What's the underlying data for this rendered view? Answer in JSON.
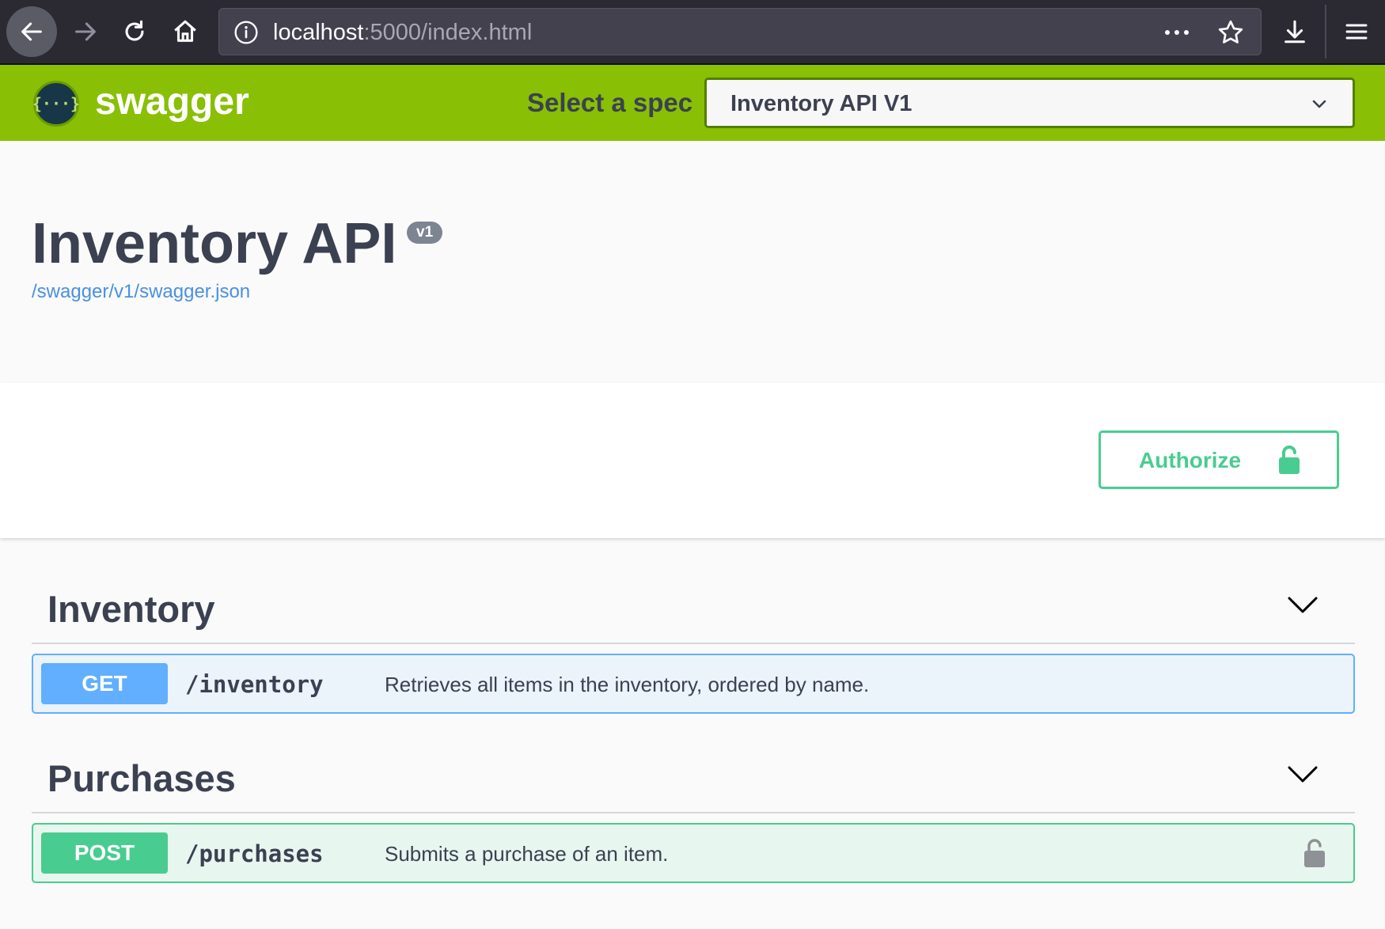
{
  "browser": {
    "url_host": "localhost",
    "url_rest": ":5000/index.html"
  },
  "topbar": {
    "logo_text": "swagger",
    "logo_glyph": "{···}",
    "spec_label": "Select a spec",
    "spec_selected": "Inventory API V1"
  },
  "info": {
    "title": "Inventory API",
    "version": "v1",
    "spec_url": "/swagger/v1/swagger.json"
  },
  "auth": {
    "authorize_label": "Authorize"
  },
  "tags": [
    {
      "name": "Inventory",
      "operations": [
        {
          "method": "GET",
          "path": "/inventory",
          "summary": "Retrieves all items in the inventory, ordered by name.",
          "locked": false
        }
      ]
    },
    {
      "name": "Purchases",
      "operations": [
        {
          "method": "POST",
          "path": "/purchases",
          "summary": "Submits a purchase of an item.",
          "locked": true
        }
      ]
    }
  ],
  "colors": {
    "topbar": "#89bf04",
    "get": "#61affe",
    "post": "#49cc90",
    "text": "#3b4151",
    "link": "#4990e2"
  },
  "icons": {
    "back": "arrow-left-icon",
    "forward": "arrow-right-icon",
    "reload": "reload-icon",
    "home": "home-icon",
    "info": "info-icon",
    "more": "more-dots-icon",
    "bookmark": "star-icon",
    "download": "download-icon",
    "menu": "hamburger-menu-icon",
    "lock": "lock-icon",
    "chevron": "chevron-down-icon"
  }
}
